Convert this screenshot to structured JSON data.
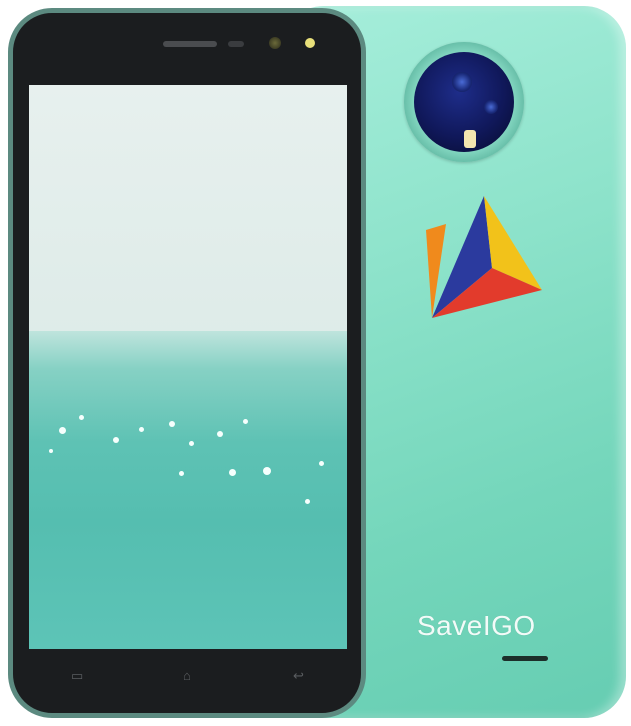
{
  "product": {
    "brand_text": "SaveIGO",
    "colors": {
      "body": "#8ee3cb",
      "bezel": "#1b1d1f",
      "lens": "#10185a",
      "logo_blue": "#2b3a9e",
      "logo_yellow": "#f2c21a",
      "logo_red": "#e23b2c",
      "logo_orange": "#f08a1c"
    }
  },
  "front": {
    "screen_wallpaper": "sea-horizon",
    "nav_icons": [
      "menu-icon",
      "home-icon",
      "back-icon"
    ]
  },
  "back": {
    "camera": "single-lens-with-flash",
    "logo": "tricolor-pyramid-logo"
  }
}
